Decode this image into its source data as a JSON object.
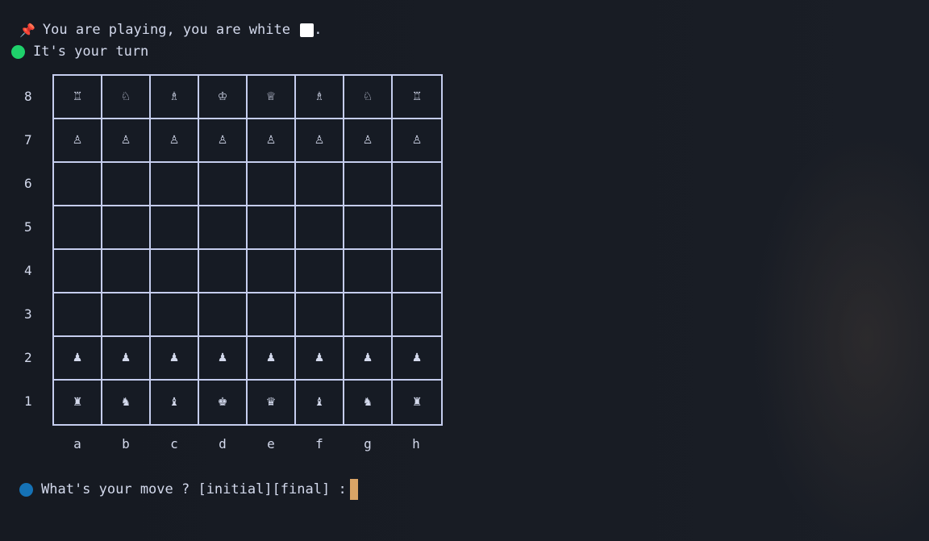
{
  "status": {
    "playing_prefix": "You are playing, you are white ",
    "playing_suffix": ".",
    "turn_text": "It's your turn",
    "prompt_text": "What's your move ? [initial][final] :"
  },
  "colors": {
    "turn_indicator": "#1fd16b",
    "prompt_indicator": "#1572b6",
    "cursor": "#d9a466",
    "grid": "#c5cdee"
  },
  "icons": {
    "pin": "pushpin-icon"
  },
  "board": {
    "ranks": [
      "8",
      "7",
      "6",
      "5",
      "4",
      "3",
      "2",
      "1"
    ],
    "files": [
      "a",
      "b",
      "c",
      "d",
      "e",
      "f",
      "g",
      "h"
    ],
    "rows": [
      [
        "♖",
        "♘",
        "♗",
        "♔",
        "♕",
        "♗",
        "♘",
        "♖"
      ],
      [
        "♙",
        "♙",
        "♙",
        "♙",
        "♙",
        "♙",
        "♙",
        "♙"
      ],
      [
        "",
        "",
        "",
        "",
        "",
        "",
        "",
        ""
      ],
      [
        "",
        "",
        "",
        "",
        "",
        "",
        "",
        ""
      ],
      [
        "",
        "",
        "",
        "",
        "",
        "",
        "",
        ""
      ],
      [
        "",
        "",
        "",
        "",
        "",
        "",
        "",
        ""
      ],
      [
        "♟",
        "♟",
        "♟",
        "♟",
        "♟",
        "♟",
        "♟",
        "♟"
      ],
      [
        "♜",
        "♞",
        "♝",
        "♚",
        "♛",
        "♝",
        "♞",
        "♜"
      ]
    ]
  }
}
